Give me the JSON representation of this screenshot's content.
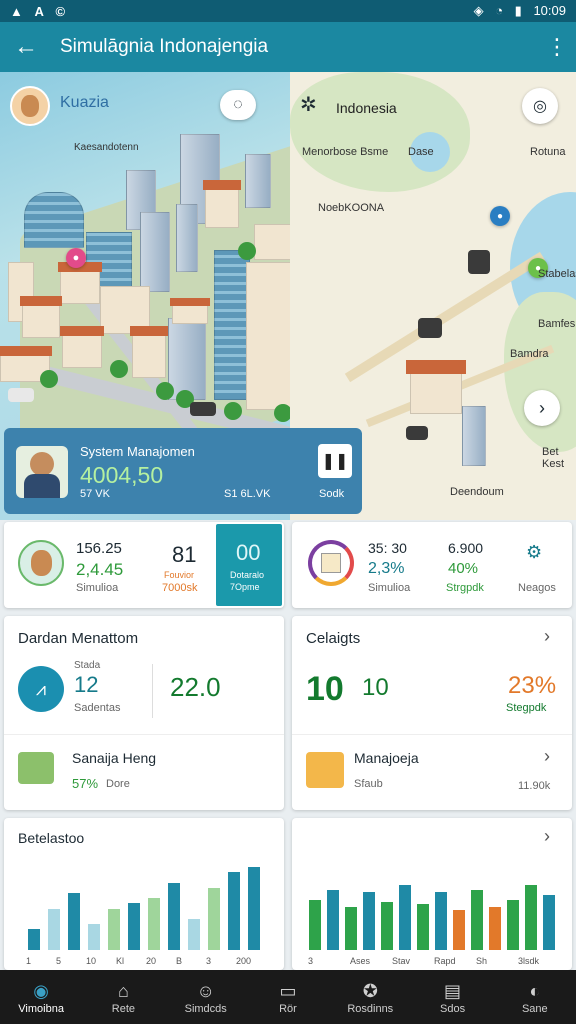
{
  "status_bar": {
    "left_icons": [
      "a-icon",
      "a-icon",
      "c-icon"
    ],
    "time": "10:09"
  },
  "app_bar": {
    "title": "Simulāgnia Indonajengia"
  },
  "hero": {
    "region_label": "Kuazia",
    "map_title": "Indonesia",
    "map_labels": [
      "Kaesandotenn",
      "Menorbose Bsme",
      "Dase",
      "Rotuna",
      "NoebKOONA",
      "Stabelas",
      "Bamdra",
      "Bamfes",
      "Bet Kest",
      "Deendoum"
    ],
    "overlay": {
      "title": "System Manajomen",
      "value": "4004,50",
      "sub_left": "57 VK",
      "sub_mid": "S1 6L.VK",
      "sub_right": "Sodk"
    }
  },
  "stat_card_left": {
    "v1": "156.25",
    "v2": "2,4.45",
    "v3": "Simulioa",
    "v4": "81",
    "v5": "Fouvior",
    "v6": "7000sk",
    "tile_value": "00",
    "tile_label1": "Dotaralo",
    "tile_label2": "7Opme"
  },
  "stat_card_right": {
    "v1": "35: 30",
    "v2": "2,3%",
    "v3": "Simulioa",
    "v4": "6.900",
    "v5": "40%",
    "v6": "Strgpdk",
    "side_label": "Neagos"
  },
  "card_dardan": {
    "title": "Dardan Menattom",
    "icon_label": "Stada",
    "value_a": "12",
    "label_a": "Sadentas",
    "value_b": "22.0",
    "row2_title": "Sanaija Heng",
    "row2_value": "57%",
    "row2_sub": "Dore"
  },
  "card_celaigts": {
    "title": "Celaigts",
    "value_a": "10",
    "value_b": "10",
    "value_c": "23%",
    "value_c_label": "Stegpdk",
    "row2_title": "Manajoeja",
    "row2_sub": "Sfaub",
    "row2_value": "11.90k"
  },
  "card_chart_left": {
    "title": "Betelastoo",
    "tick_labels": [
      "1",
      "5",
      "10",
      "Kl",
      "20",
      "B",
      "3",
      "200"
    ]
  },
  "card_chart_right": {
    "tick_labels": [
      "3",
      "Ases",
      "Stav",
      "Rapd",
      "Sh",
      "3lsdk"
    ]
  },
  "chart_data": [
    {
      "type": "bar",
      "title": "Betelastoo",
      "values": [
        20,
        40,
        55,
        25,
        40,
        45,
        50,
        65,
        30,
        60,
        75,
        80
      ],
      "colors": [
        "#1f8aa6",
        "#a9d7e3",
        "#1f8aa6",
        "#a9d7e3",
        "#9fd59b",
        "#1f8aa6",
        "#9fd59b",
        "#1f8aa6",
        "#a9d7e3",
        "#9fd59b",
        "#1f8aa6",
        "#1f8aa6"
      ]
    },
    {
      "type": "bar",
      "values": [
        35,
        42,
        30,
        40,
        33,
        45,
        32,
        40,
        28,
        42,
        30,
        35,
        45,
        38
      ],
      "colors": [
        "#2ea34a",
        "#1f8aa6",
        "#2ea34a",
        "#1f8aa6",
        "#2ea34a",
        "#1f8aa6",
        "#2ea34a",
        "#1f8aa6",
        "#e2792a",
        "#2ea34a",
        "#e2792a",
        "#2ea34a",
        "#2ea34a",
        "#1f8aa6"
      ]
    }
  ],
  "bottom_nav": [
    {
      "label": "Vimoibna",
      "icon": "compass-icon",
      "active": true
    },
    {
      "label": "Rete",
      "icon": "home-icon",
      "active": false
    },
    {
      "label": "Simdcds",
      "icon": "person-icon",
      "active": false
    },
    {
      "label": "Rör",
      "icon": "folder-icon",
      "active": false
    },
    {
      "label": "Rosdinns",
      "icon": "run-icon",
      "active": false
    },
    {
      "label": "Sdos",
      "icon": "grid-icon",
      "active": false
    },
    {
      "label": "Sane",
      "icon": "bulb-icon",
      "active": false
    }
  ]
}
